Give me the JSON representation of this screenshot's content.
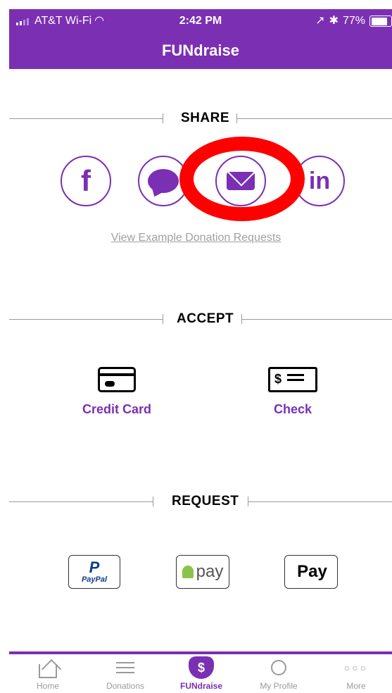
{
  "status_bar": {
    "carrier": "AT&T Wi-Fi",
    "time": "2:42 PM",
    "battery": "77%"
  },
  "nav": {
    "title": "FUNdraise"
  },
  "share": {
    "header": "SHARE",
    "buttons": [
      {
        "name": "facebook",
        "glyph": "f"
      },
      {
        "name": "message",
        "glyph": ""
      },
      {
        "name": "email",
        "glyph": ""
      },
      {
        "name": "linkedin",
        "glyph": "in"
      }
    ],
    "example_link": "View Example Donation Requests"
  },
  "accept": {
    "header": "ACCEPT",
    "items": [
      {
        "label": "Credit Card",
        "icon": "credit-card-icon"
      },
      {
        "label": "Check",
        "icon": "check-icon",
        "dollar": "$"
      }
    ]
  },
  "request": {
    "header": "REQUEST",
    "badges": [
      {
        "name": "paypal",
        "mark": "P",
        "text": "PayPal"
      },
      {
        "name": "android-pay",
        "text": "pay"
      },
      {
        "name": "apple-pay",
        "mark": "",
        "text": "Pay"
      }
    ]
  },
  "tabbar": {
    "tabs": [
      {
        "label": "Home",
        "icon": "home-icon"
      },
      {
        "label": "Donations",
        "icon": "list-icon"
      },
      {
        "label": "FUNdraise",
        "icon": "heart-dollar-icon",
        "active": true,
        "glyph": "$"
      },
      {
        "label": "My Profile",
        "icon": "person-icon"
      },
      {
        "label": "More",
        "icon": "more-icon",
        "glyph": "○○○"
      }
    ]
  },
  "colors": {
    "brand": "#7b2fb3",
    "highlight": "#ff0000"
  }
}
